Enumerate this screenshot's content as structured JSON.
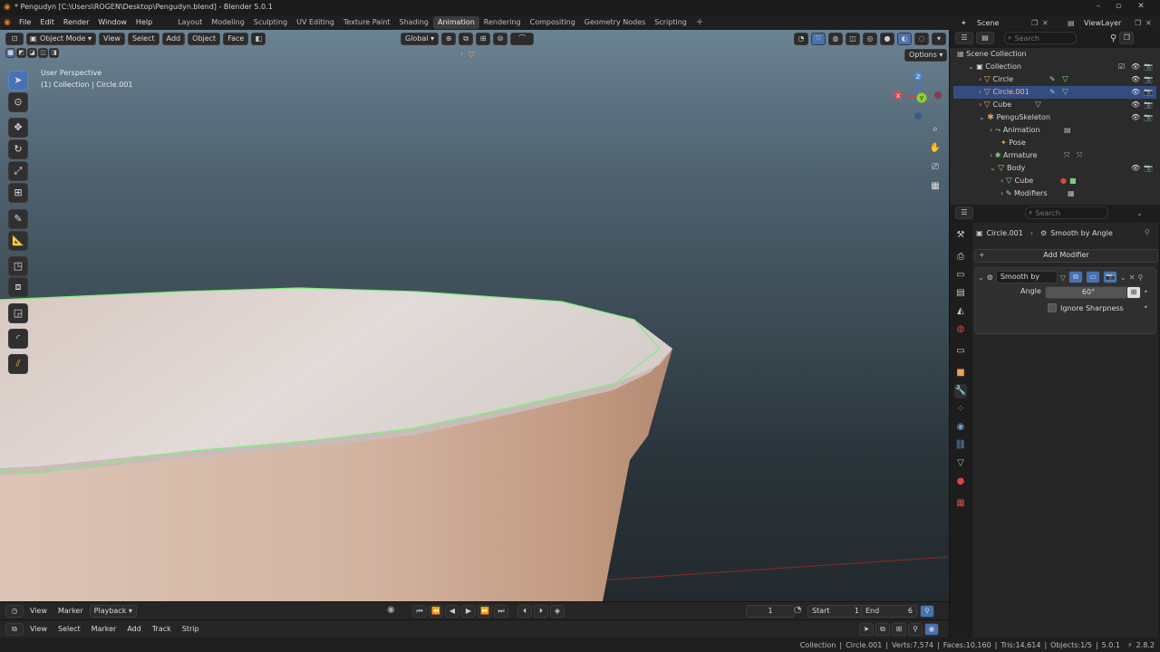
{
  "window": {
    "title": "* Pengudyn [C:\\Users\\ROGEN\\Desktop\\Pengudyn.blend] - Blender 5.0.1"
  },
  "menu": {
    "items": [
      "File",
      "Edit",
      "Render",
      "Window",
      "Help"
    ]
  },
  "workspaces": [
    "Layout",
    "Modeling",
    "Sculpting",
    "UV Editing",
    "Texture Paint",
    "Shading",
    "Animation",
    "Rendering",
    "Compositing",
    "Geometry Nodes",
    "Scripting"
  ],
  "active_workspace": "Animation",
  "scene": {
    "name": "Scene",
    "view_layer": "ViewLayer"
  },
  "viewport_header": {
    "mode": "Object Mode",
    "menus": [
      "View",
      "Select",
      "Add",
      "Object",
      "Face"
    ],
    "orientation": "Global",
    "options_label": "Options"
  },
  "viewport": {
    "view_name": "User Perspective",
    "context": "(1) Collection | Circle.001",
    "gizmo_axes": {
      "x": "X",
      "y": "Y",
      "z": "Z"
    }
  },
  "outliner": {
    "search_placeholder": "Search",
    "scene_collection": "Scene Collection",
    "collection": "Collection",
    "items": [
      {
        "label": "Circle"
      },
      {
        "label": "Circle.001"
      },
      {
        "label": "Cube"
      },
      {
        "label": "PenguSkeleton"
      },
      {
        "label": "Animation"
      },
      {
        "label": "Pose"
      },
      {
        "label": "Armature"
      },
      {
        "label": "Body"
      },
      {
        "label": "Cube"
      },
      {
        "label": "Modifiers"
      }
    ]
  },
  "properties": {
    "search_placeholder": "Search",
    "breadcrumb_object": "Circle.001",
    "breadcrumb_modifier": "Smooth by Angle",
    "add_modifier": "Add Modifier",
    "modifier_name": "Smooth by An...",
    "angle_label": "Angle",
    "angle_value": "60°",
    "ignore_sharpness_label": "Ignore Sharpness",
    "ignore_sharpness_checked": false
  },
  "timeline": {
    "menus": [
      "View",
      "Marker"
    ],
    "playback": "Playback",
    "current_frame": "1",
    "start_label": "Start",
    "start_value": "1",
    "end_label": "End",
    "end_value": "6"
  },
  "strip_editor": {
    "menus": [
      "View",
      "Select",
      "Marker",
      "Add",
      "Track",
      "Strip"
    ]
  },
  "status": {
    "collection": "Collection",
    "object": "Circle.001",
    "verts": "Verts:7,574",
    "faces": "Faces:10,160",
    "tris": "Tris:14,614",
    "objects": "Objects:1/5",
    "version": "5.0.1",
    "extra": "2.8.2"
  },
  "colors": {
    "accent": "#4772b3",
    "selection_outline": "#7cf07c",
    "selected_row": "#334d80",
    "mesh_light": "#dcd1cd",
    "mesh_dark": "#b99782"
  }
}
